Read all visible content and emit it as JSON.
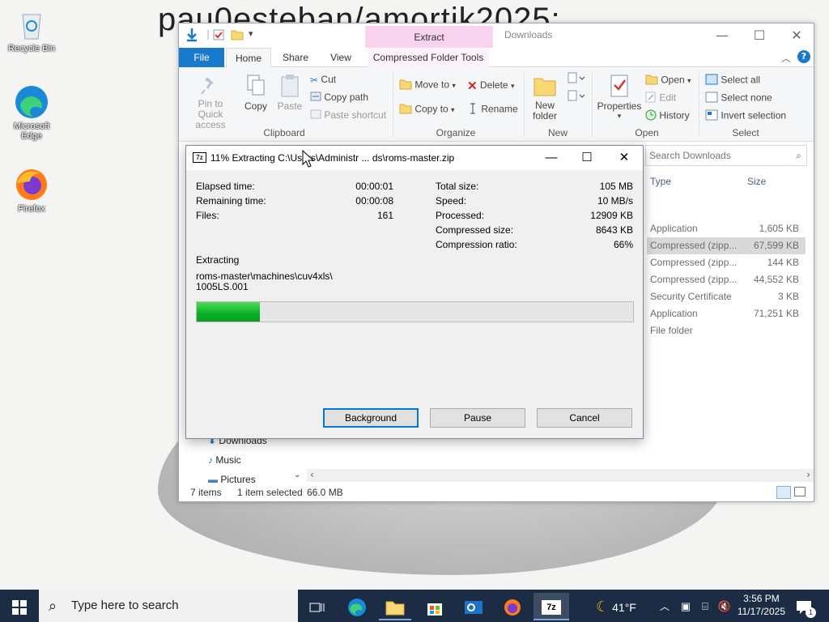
{
  "desktop": {
    "wallpaper_text": "pau0esteban/amortik2025:",
    "icons": [
      {
        "label": "Recycle Bin",
        "icon": "recycle-bin-icon"
      },
      {
        "label": "Microsoft Edge",
        "icon": "edge-icon"
      },
      {
        "label": "Firefox",
        "icon": "firefox-icon"
      }
    ]
  },
  "explorer": {
    "title": "Downloads",
    "contextual_tab_group": "Extract",
    "tabs": {
      "file": "File",
      "home": "Home",
      "share": "Share",
      "view": "View",
      "compressed": "Compressed Folder Tools"
    },
    "clipboard": {
      "pin": "Pin to Quick access",
      "copy": "Copy",
      "paste": "Paste",
      "cut": "Cut",
      "copy_path": "Copy path",
      "paste_shortcut": "Paste shortcut",
      "group": "Clipboard"
    },
    "organize": {
      "move_to": "Move to",
      "copy_to": "Copy to",
      "delete": "Delete",
      "rename": "Rename",
      "group": "Organize"
    },
    "new": {
      "new_folder": "New folder",
      "group": "New"
    },
    "open": {
      "properties": "Properties",
      "open": "Open",
      "edit": "Edit",
      "history": "History",
      "group": "Open"
    },
    "select": {
      "select_all": "Select all",
      "select_none": "Select none",
      "invert": "Invert selection",
      "group": "Select"
    },
    "search_placeholder": "Search Downloads",
    "columns": {
      "type": "Type",
      "size": "Size"
    },
    "files": [
      {
        "type": "Application",
        "size": "1,605 KB",
        "selected": false
      },
      {
        "type": "Compressed (zipp...",
        "size": "67,599 KB",
        "selected": true
      },
      {
        "type": "Compressed (zipp...",
        "size": "144 KB",
        "selected": false
      },
      {
        "type": "Compressed (zipp...",
        "size": "44,552 KB",
        "selected": false
      },
      {
        "type": "Security Certificate",
        "size": "3 KB",
        "selected": false
      },
      {
        "type": "Application",
        "size": "71,251 KB",
        "selected": false
      },
      {
        "type": "File folder",
        "size": "",
        "selected": false
      }
    ],
    "nav": {
      "downloads": "Downloads",
      "music": "Music",
      "pictures": "Pictures"
    },
    "status": {
      "items": "7 items",
      "selected": "1 item selected",
      "size": "66.0 MB"
    }
  },
  "dialog": {
    "title": "11% Extracting C:\\Users\\Administr ... ds\\roms-master.zip",
    "icon_text": "7z",
    "stats_left": [
      {
        "label": "Elapsed time:",
        "value": "00:00:01"
      },
      {
        "label": "Remaining time:",
        "value": "00:00:08"
      },
      {
        "label": "Files:",
        "value": "161"
      }
    ],
    "stats_right": [
      {
        "label": "Total size:",
        "value": "105 MB"
      },
      {
        "label": "Speed:",
        "value": "10 MB/s"
      },
      {
        "label": "Processed:",
        "value": "12909 KB"
      },
      {
        "label": "Compressed size:",
        "value": "8643 KB"
      },
      {
        "label": "Compression ratio:",
        "value": "66%"
      }
    ],
    "status_label": "Extracting",
    "current_path": "roms-master\\machines\\cuv4xls\\",
    "current_file": "1005LS.001",
    "progress": 0.145,
    "buttons": {
      "background": "Background",
      "pause": "Pause",
      "cancel": "Cancel"
    }
  },
  "taskbar": {
    "search_placeholder": "Type here to search",
    "weather": "41°F",
    "time": "3:56 PM",
    "date": "11/17/2025",
    "notification_count": "1"
  }
}
